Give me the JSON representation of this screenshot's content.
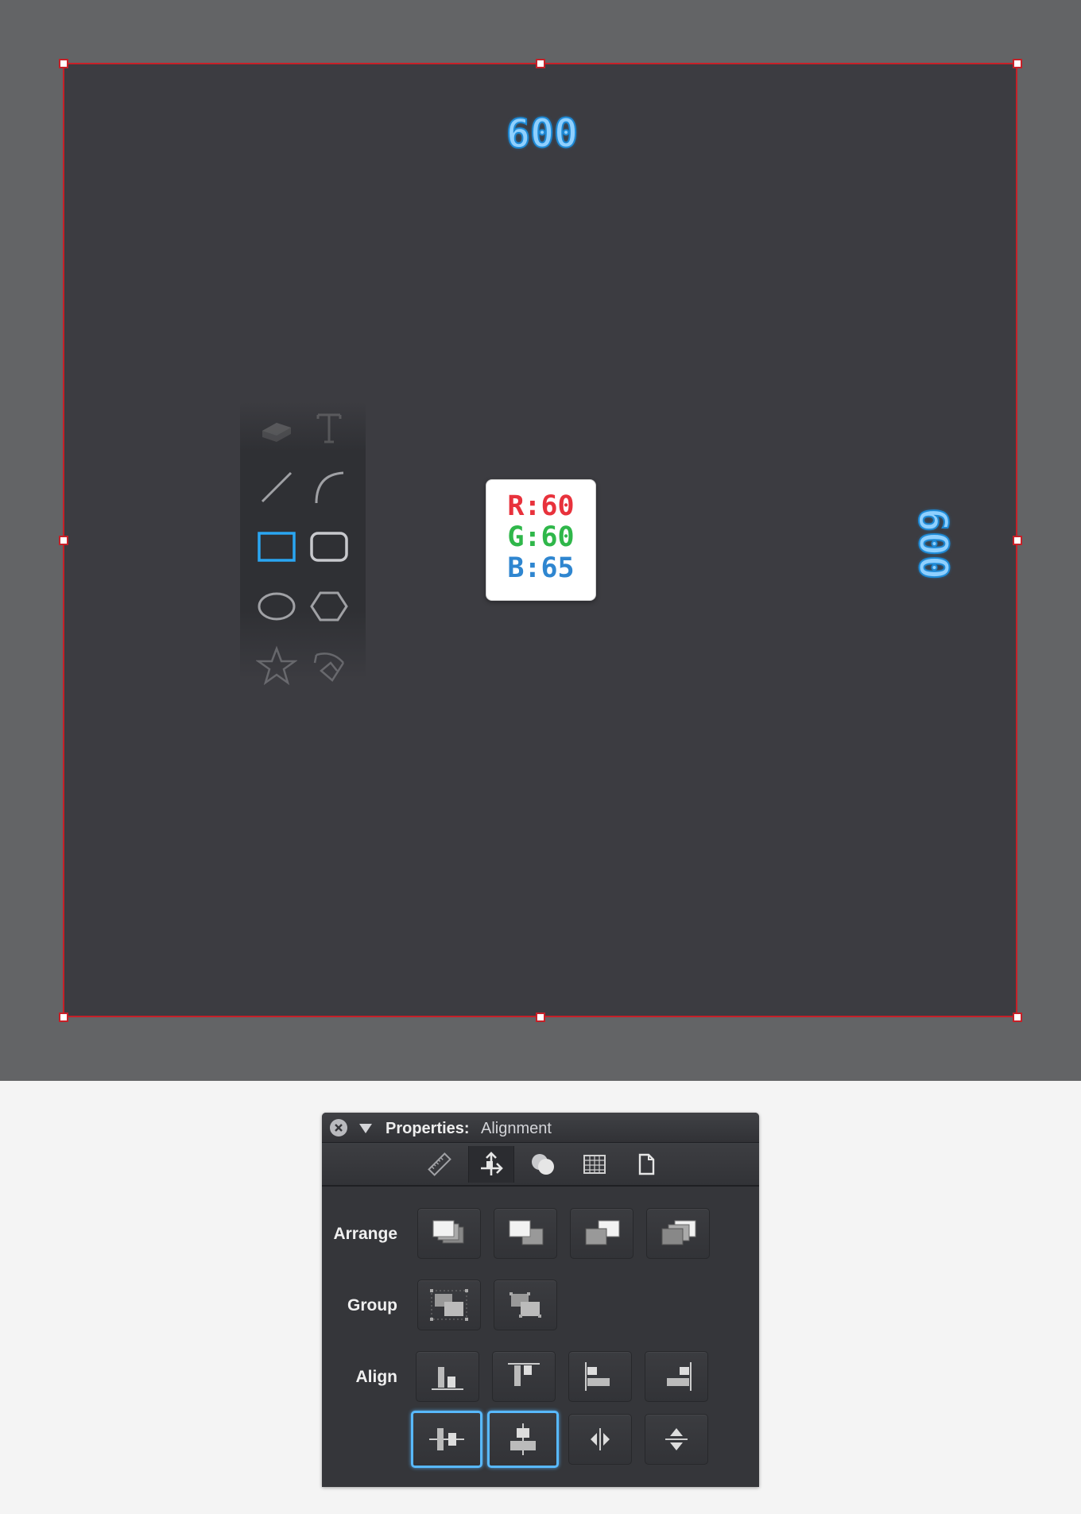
{
  "canvas": {
    "width_label": "600",
    "height_label": "600",
    "swatch": {
      "r": "R:60",
      "g": "G:60",
      "b": "B:65"
    },
    "colors": {
      "artboard": "#3c3c41",
      "outer": "#636466",
      "selection": "#c62028",
      "dimension_text": "#8fd0ff"
    }
  },
  "tool_palette": {
    "tools": [
      {
        "name": "eraser-icon"
      },
      {
        "name": "text-icon"
      },
      {
        "name": "line-icon"
      },
      {
        "name": "arc-icon"
      },
      {
        "name": "rectangle-icon",
        "selected": true
      },
      {
        "name": "rounded-rectangle-icon"
      },
      {
        "name": "ellipse-icon"
      },
      {
        "name": "polygon-icon"
      },
      {
        "name": "star-icon"
      },
      {
        "name": "spiral-icon"
      }
    ]
  },
  "panel": {
    "title_bold": "Properties:",
    "title_normal": "Alignment",
    "tabs": [
      "ruler-icon",
      "alignment-icon",
      "style-icon",
      "grid-icon",
      "document-icon"
    ],
    "active_tab": "alignment-icon",
    "rows": {
      "arrange_label": "Arrange",
      "group_label": "Group",
      "align_label": "Align"
    },
    "arrange_buttons": [
      "bring-to-front-icon",
      "bring-forward-icon",
      "send-backward-icon",
      "send-to-back-icon"
    ],
    "group_buttons": [
      "group-icon",
      "ungroup-icon"
    ],
    "align_buttons": [
      "align-bottom-icon",
      "align-top-icon",
      "align-left-icon",
      "align-right-icon"
    ],
    "align_buttons_row2": [
      "align-horizontal-center-icon",
      "align-vertical-center-icon",
      "distribute-horizontal-icon",
      "distribute-vertical-icon"
    ],
    "selected_align": [
      "align-horizontal-center-icon",
      "align-vertical-center-icon"
    ]
  }
}
